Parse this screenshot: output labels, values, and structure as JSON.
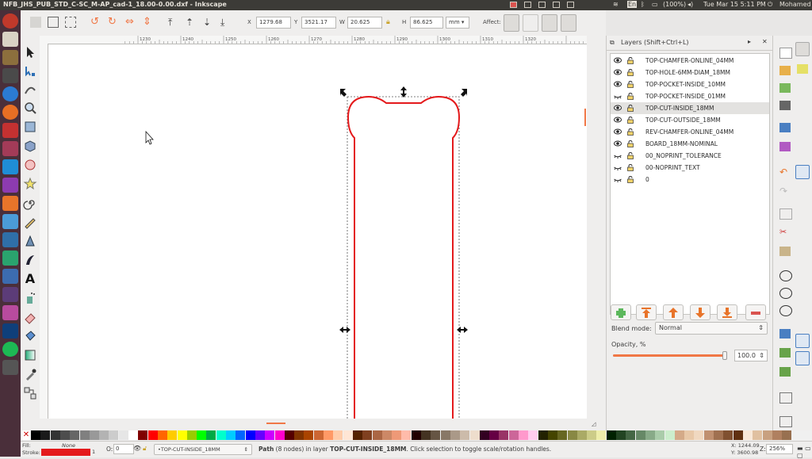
{
  "window": {
    "title": "NFB_JHS_PUB_STD_C-SC_M-AP_cad-1_18.00-0.00.dxf - Inkscape"
  },
  "system_tray": {
    "language": "En",
    "battery": "(100%)",
    "clock": "Tue Mar 15  5:11 PM",
    "user": "Mohamed"
  },
  "toolbar": {
    "x_label": "X",
    "x_value": "1279.68",
    "y_label": "Y",
    "y_value": "3521.17",
    "w_label": "W",
    "w_value": "20.625",
    "h_label": "H",
    "h_value": "86.625",
    "unit": "mm",
    "affect_label": "Affect:"
  },
  "ruler": {
    "labels": [
      "1230",
      "1240",
      "1250",
      "1260",
      "1270",
      "1280",
      "1290",
      "1300",
      "1310",
      "1320"
    ]
  },
  "layers_panel": {
    "title": "Layers (Shift+Ctrl+L)",
    "layers": [
      {
        "name": "TOP-CHAMFER-ONLINE_04MM",
        "visible": true,
        "selected": false
      },
      {
        "name": "TOP-HOLE-6MM-DIAM_18MM",
        "visible": true,
        "selected": false
      },
      {
        "name": "TOP-POCKET-INSIDE_10MM",
        "visible": true,
        "selected": false
      },
      {
        "name": "TOP-POCKET-INSIDE_01MM",
        "visible": false,
        "selected": false
      },
      {
        "name": "TOP-CUT-INSIDE_18MM",
        "visible": true,
        "selected": true
      },
      {
        "name": "TOP-CUT-OUTSIDE_18MM",
        "visible": true,
        "selected": false
      },
      {
        "name": "REV-CHAMFER-ONLINE_04MM",
        "visible": true,
        "selected": false
      },
      {
        "name": "BOARD_18MM-NOMINAL",
        "visible": true,
        "selected": false
      },
      {
        "name": "00_NOPRINT_TOLERANCE",
        "visible": false,
        "selected": false
      },
      {
        "name": "00-NOPRINT_TEXT",
        "visible": false,
        "selected": false
      },
      {
        "name": "0",
        "visible": false,
        "selected": false
      }
    ],
    "blend_label": "Blend mode:",
    "blend_value": "Normal",
    "opacity_label": "Opacity, %",
    "opacity_value": "100.0",
    "opacity_fraction": 1.0
  },
  "status": {
    "fill_label": "Fill:",
    "fill_value": "None",
    "stroke_label": "Stroke:",
    "stroke_width": "1",
    "opacity_label": "O:",
    "opacity_value": "0",
    "layer_select": "•TOP-CUT-INSIDE_18MM",
    "message_prefix": "Path",
    "message_mid": " (8 nodes) in layer ",
    "message_layer": "TOP-CUT-INSIDE_18MM",
    "message_suffix": ". Click selection to toggle scale/rotation handles.",
    "cursor_x": "X: 1244.09",
    "cursor_y": "Y: 3600.98",
    "zoom_label": "Z:",
    "zoom_value": "256%"
  },
  "colors": {
    "stroke": "#e41a1c",
    "accent": "#f07746",
    "launcher": "#4a2f3a"
  },
  "palette": [
    "#000000",
    "#1a1a1a",
    "#333333",
    "#4d4d4d",
    "#666666",
    "#808080",
    "#999999",
    "#b3b3b3",
    "#cccccc",
    "#e6e6e6",
    "#ffffff",
    "#800000",
    "#ff0000",
    "#ff6600",
    "#ffcc00",
    "#ffff00",
    "#99cc00",
    "#00ff00",
    "#00aa44",
    "#00ffcc",
    "#00ccff",
    "#0066ff",
    "#0000ff",
    "#6600ff",
    "#cc00ff",
    "#ff00cc",
    "#550000",
    "#803300",
    "#aa4400",
    "#cc6633",
    "#ff9966",
    "#ffccaa",
    "#ffe6d5",
    "#552200",
    "#804020",
    "#aa6644",
    "#cc8866",
    "#ee9977",
    "#ffbbaa",
    "#220000",
    "#443322",
    "#665544",
    "#887766",
    "#aa9988",
    "#ccbbaa",
    "#eeddcc",
    "#330022",
    "#660044",
    "#993366",
    "#cc6699",
    "#ff99cc",
    "#ffccee",
    "#222200",
    "#444400",
    "#666622",
    "#888844",
    "#aaaa66",
    "#cccc88",
    "#eeeeaa",
    "#002200",
    "#224422",
    "#446644",
    "#668866",
    "#88aa88",
    "#aaccaa",
    "#cceecc",
    "#d4aa88",
    "#e8c8a8",
    "#f0d8c0",
    "#c09070",
    "#a07050",
    "#805030",
    "#603010",
    "#f8e8d8",
    "#e0c0a0",
    "#c8a080",
    "#b08060",
    "#987050"
  ]
}
